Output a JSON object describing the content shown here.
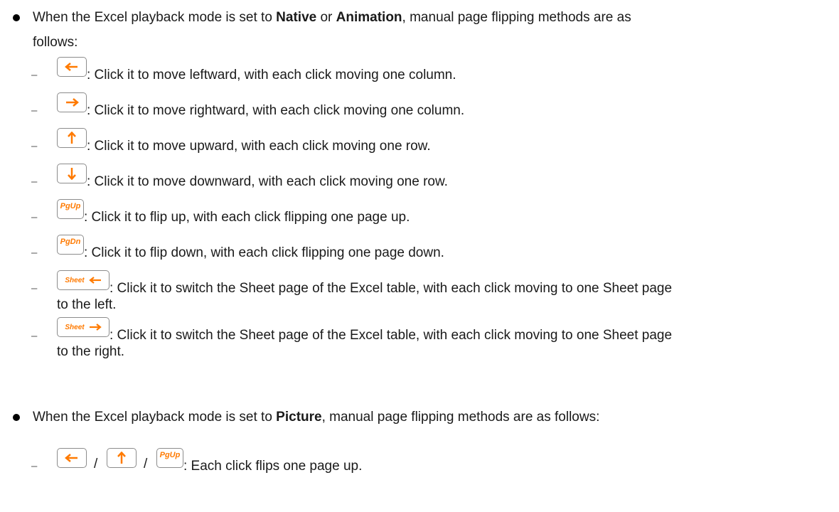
{
  "bullet1": {
    "pre": "When the Excel playback mode is set to ",
    "mode1": "Native",
    "or": " or ",
    "mode2": "Animation",
    "post": ", manual page flipping methods are as",
    "line2": "follows:"
  },
  "items": [
    {
      "key": "left-arrow",
      "text": ": Click it to move leftward, with each click moving one column."
    },
    {
      "key": "right-arrow",
      "text": ": Click it to move rightward, with each click moving one column."
    },
    {
      "key": "up-arrow",
      "text": ": Click it to move upward, with each click moving one row."
    },
    {
      "key": "down-arrow",
      "text": ": Click it to move downward, with each click moving one row."
    },
    {
      "key": "PgUp",
      "text": ": Click it to flip up, with each click flipping one page up."
    },
    {
      "key": "PgDn",
      "text": ": Click it to flip down, with each click flipping one page down."
    },
    {
      "key": "Sheet",
      "text": ": Click it to switch the Sheet page of the Excel table, with each click moving to one Sheet page",
      "cont": "to the left."
    },
    {
      "key": "Sheet",
      "text": ": Click it to switch the Sheet page of the Excel table, with each click moving to one Sheet page",
      "cont": "to the right."
    }
  ],
  "bullet2": {
    "pre": "When the Excel playback mode is set to ",
    "mode": "Picture",
    "post": ", manual page flipping methods are as follows:"
  },
  "picture_item": {
    "sep1": "/",
    "sep2": "/",
    "text": ": Each click flips one page up."
  },
  "key_labels": {
    "pgup": "PgUp",
    "pgdn": "PgDn",
    "sheet": "Sheet"
  },
  "dash": "–",
  "colors": {
    "arrow": "#ff7a00",
    "key_border": "#8c8c8c",
    "text": "#1a1a1a"
  }
}
